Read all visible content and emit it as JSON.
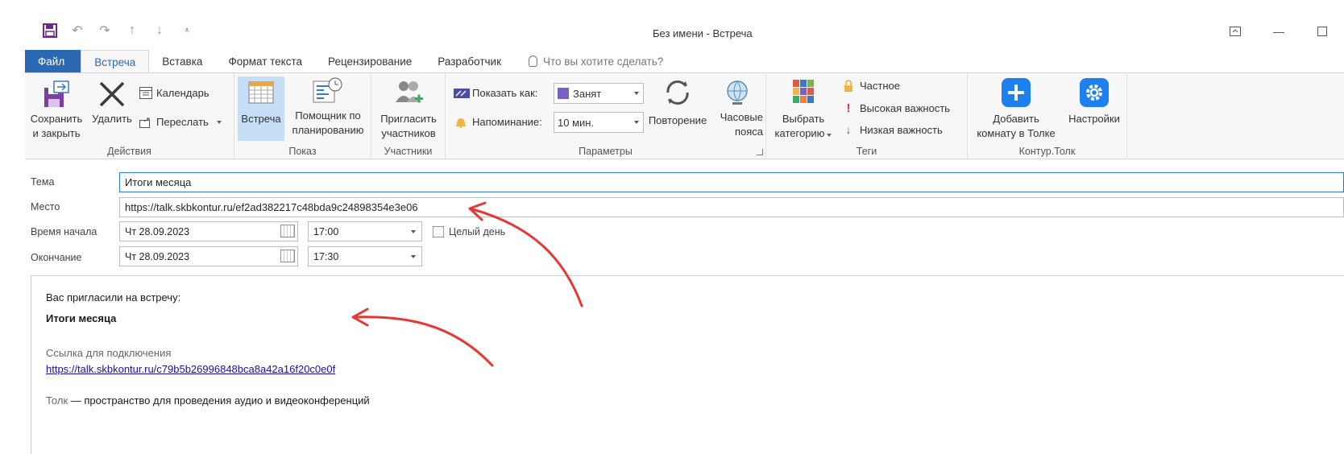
{
  "window": {
    "title": "Без имени - Встреча",
    "qat_icons": [
      "save-icon",
      "undo-icon",
      "redo-icon",
      "arrow-up-icon",
      "arrow-down-icon",
      "customize-qat-icon"
    ],
    "controls": [
      "ribbon-display-icon",
      "minimize-icon",
      "maximize-icon"
    ]
  },
  "tabs": {
    "file": "Файл",
    "meeting": "Встреча",
    "insert": "Вставка",
    "format": "Формат текста",
    "review": "Рецензирование",
    "developer": "Разработчик",
    "tell_me": "Что вы хотите сделать?"
  },
  "ribbon": {
    "actions": {
      "label": "Действия",
      "save_close_1": "Сохранить",
      "save_close_2": "и закрыть",
      "delete": "Удалить",
      "calendar": "Календарь",
      "forward": "Переслать"
    },
    "show": {
      "label": "Показ",
      "meeting": "Встреча",
      "assistant_1": "Помощник по",
      "assistant_2": "планированию"
    },
    "attendees": {
      "label": "Участники",
      "invite_1": "Пригласить",
      "invite_2": "участников"
    },
    "options": {
      "label": "Параметры",
      "show_as": "Показать как:",
      "show_as_value": "Занят",
      "reminder": "Напоминание:",
      "reminder_value": "10 мин.",
      "recurrence": "Повторение",
      "timezones_1": "Часовые",
      "timezones_2": "пояса"
    },
    "tags": {
      "label": "Теги",
      "categorize_1": "Выбрать",
      "categorize_2": "категорию",
      "private": "Частное",
      "high": "Высокая важность",
      "low": "Низкая важность"
    },
    "kontur": {
      "label": "Контур.Толк",
      "add_room_1": "Добавить",
      "add_room_2": "комнату в Толке",
      "settings": "Настройки"
    },
    "colors": {
      "accent": "#2b69b4",
      "kontur_blue": "#1e7ff0",
      "busy": "#7a5fc4"
    }
  },
  "form": {
    "subject_label": "Тема",
    "subject_value": "Итоги месяца",
    "location_label": "Место",
    "location_value": "https://talk.skbkontur.ru/ef2ad382217c48bda9c24898354e3e06",
    "start_label": "Время начала",
    "start_date": "Чт 28.09.2023",
    "start_time": "17:00",
    "all_day": "Целый день",
    "end_label": "Окончание",
    "end_date": "Чт 28.09.2023",
    "end_time": "17:30"
  },
  "body": {
    "invited": "Вас пригласили на встречу:",
    "title": "Итоги месяца",
    "link_label": "Ссылка для подключения",
    "link": "https://talk.skbkontur.ru/c79b5b26996848bca8a42a16f20c0e0f",
    "tolk_name": "Толк",
    "tolk_desc": " — пространство для проведения аудио и видеоконференций"
  },
  "annotations": {
    "arrow_color": "#e53935"
  }
}
